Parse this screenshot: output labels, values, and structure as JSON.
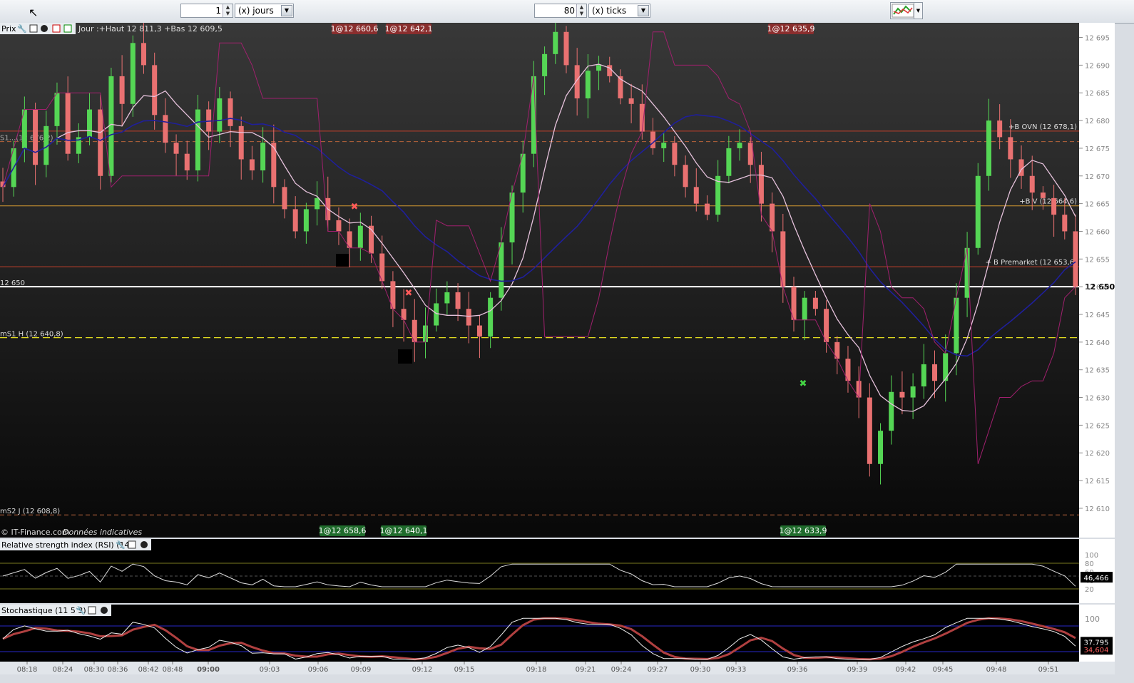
{
  "toolbar": {
    "days_value": "1",
    "days_unit": "(x) jours",
    "ticks_value": "80",
    "ticks_unit": "(x) ticks"
  },
  "price_panel": {
    "title": "Prix",
    "info": "Jour :+Haut 12 811,3 +Bas 12 609,5",
    "copyright": "© IT-Finance.com",
    "disclaimer": "Données indicatives",
    "current_line_label": "12 650",
    "current_price_tag": "12 650",
    "level_labels": {
      "s1": "mS1 H (12 640,8)",
      "s2": "mS2 J (12 608,8)",
      "ovn": "+B OVN (12 678,1)",
      "bv": "+B V (12 664,6)",
      "premarket": "+ B Premarket (12 653,6)",
      "left_partial": "S1...(12 676,2)"
    },
    "top_markers": [
      "1@12 660,6",
      "1@12 642,1",
      "1@12 635,9"
    ],
    "bottom_markers": [
      "1@12 658,6",
      "1@12 640,1",
      "1@12 633,9"
    ]
  },
  "rsi_panel": {
    "title": "Relative strength index (RSI) (14)",
    "axis": [
      "100",
      "80",
      "60",
      "40",
      "20"
    ],
    "value": "46,466"
  },
  "stoch_panel": {
    "title": "Stochastique (11 5 3)",
    "axis_top": "100",
    "value_k": "37,795",
    "value_d": "34,604"
  },
  "x_ticks": [
    "08:18",
    "08:24",
    "08:30",
    "08:36",
    "08:42",
    "08:48",
    "09:00",
    "09:03",
    "09:06",
    "09:09",
    "09:12",
    "09:15",
    "09:18",
    "09:21",
    "09:24",
    "09:27",
    "09:30",
    "09:33",
    "09:36",
    "09:39",
    "09:42",
    "09:45",
    "09:48",
    "09:51"
  ],
  "colors": {
    "up": "#55d655",
    "down": "#e97171",
    "ma_slow": "#1f1f9a",
    "ma_fast": "#e6c2dc",
    "band": "#a0206e"
  },
  "chart_data": {
    "type": "candlestick",
    "y_ticks": [
      12695,
      12690,
      12685,
      12680,
      12675,
      12670,
      12665,
      12660,
      12655,
      12650,
      12645,
      12640,
      12635,
      12630,
      12625,
      12620,
      12615,
      12610
    ],
    "ylim": [
      12606,
      12697
    ],
    "levels": [
      {
        "name": "current",
        "value": 12650
      },
      {
        "name": "mS1 H",
        "value": 12640.8
      },
      {
        "name": "mS2 J",
        "value": 12608.8
      },
      {
        "name": "B OVN",
        "value": 12678.1
      },
      {
        "name": "B V",
        "value": 12664.6
      },
      {
        "name": "B Premarket",
        "value": 12653.6
      },
      {
        "name": "S1",
        "value": 12676.2
      }
    ],
    "close_path": [
      12668,
      12675,
      12682,
      12672,
      12679,
      12685,
      12674,
      12677,
      12682,
      12670,
      12688,
      12683,
      12694,
      12690,
      12681,
      12676,
      12674,
      12671,
      12682,
      12678,
      12684,
      12679,
      12673,
      12671,
      12676,
      12668,
      12664,
      12660,
      12664,
      12666,
      12662,
      12660,
      12657,
      12661,
      12656,
      12651,
      12646,
      12644,
      12640,
      12643,
      12647,
      12649,
      12646,
      12643,
      12641,
      12648,
      12658,
      12667,
      12674,
      12688,
      12692,
      12696,
      12690,
      12684,
      12689,
      12690,
      12688,
      12684,
      12683,
      12678,
      12675,
      12676,
      12672,
      12668,
      12665,
      12663,
      12670,
      12675,
      12676,
      12672,
      12665,
      12660,
      12650,
      12644,
      12648,
      12646,
      12640,
      12637,
      12633,
      12630,
      12618,
      12624,
      12631,
      12630,
      12632,
      12636,
      12633,
      12638,
      12648,
      12657,
      12670,
      12680,
      12677,
      12673,
      12670,
      12667,
      12666,
      12663,
      12660,
      12650
    ],
    "rsi": {
      "ylim": [
        0,
        100
      ],
      "upper": 80,
      "lower": 20,
      "last": 46.466
    },
    "stochastic": {
      "ylim": [
        0,
        100
      ],
      "upper": 80,
      "lower": 20,
      "k_last": 37.795,
      "d_last": 34.604
    }
  }
}
